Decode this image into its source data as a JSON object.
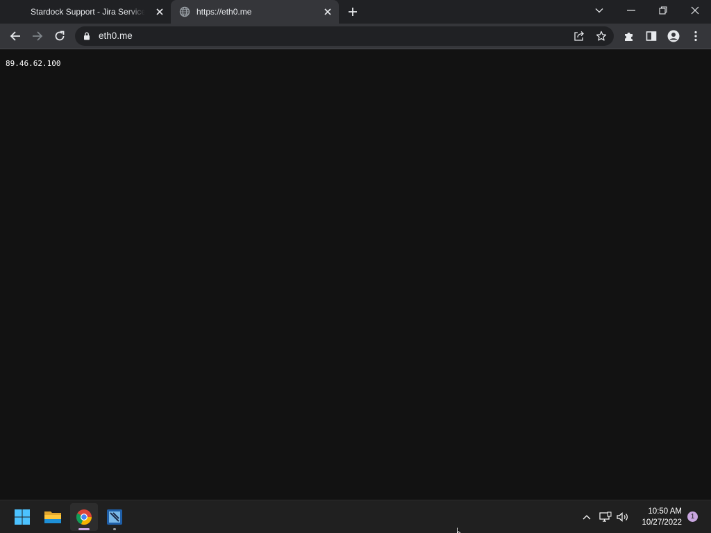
{
  "browser": {
    "tabs": [
      {
        "title": "Stardock Support - Jira Service Management",
        "active": false
      },
      {
        "title": "https://eth0.me",
        "active": true
      }
    ],
    "address": "eth0.me"
  },
  "page": {
    "ip_text": "89.46.62.100"
  },
  "taskbar": {
    "apps": [
      "start-icon",
      "file-explorer-icon",
      "chrome-icon",
      "app-icon"
    ],
    "clock_time": "10:50 AM",
    "clock_date": "10/27/2022",
    "notification_count": "1"
  },
  "colors": {
    "tabstrip": "#202124",
    "toolbar": "#35363a",
    "page_bg": "#121212",
    "taskbar": "#202020",
    "accent": "#c9a6e0"
  }
}
